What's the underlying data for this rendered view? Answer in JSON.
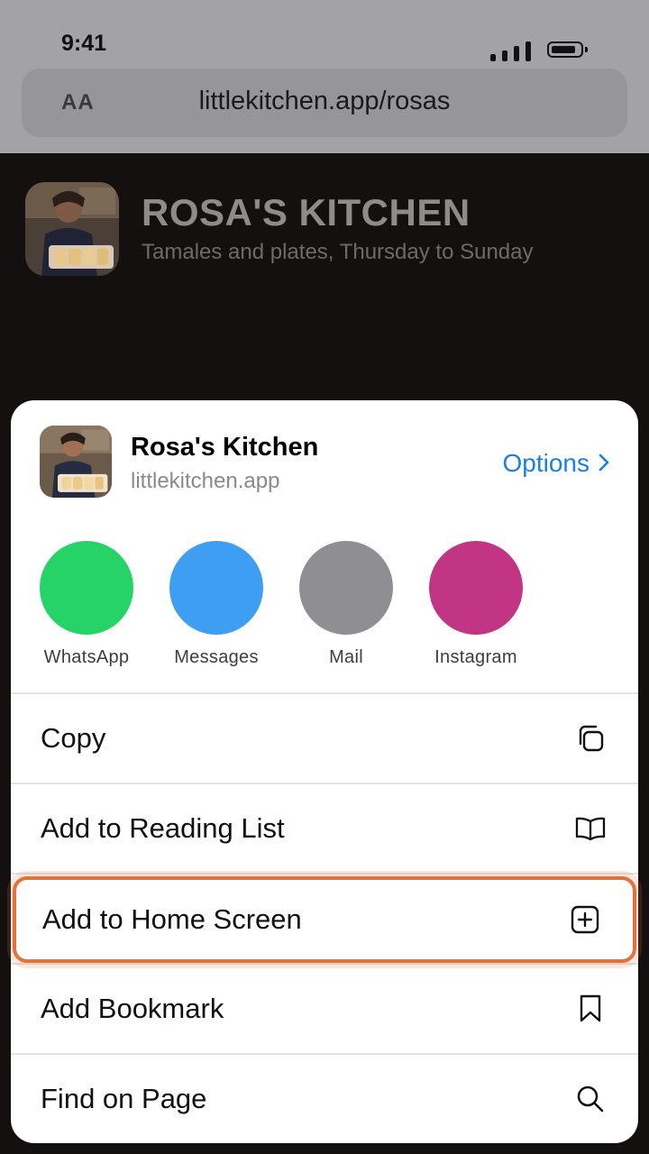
{
  "status_bar": {
    "time": "9:41"
  },
  "browser": {
    "text_size_label": "AA",
    "url": "littlekitchen.app/rosas"
  },
  "site": {
    "title": "ROSA'S KITCHEN",
    "subtitle": "Tamales and plates, Thursday to Sunday"
  },
  "share_sheet": {
    "title": "Rosa's Kitchen",
    "domain": "littlekitchen.app",
    "options_label": "Options",
    "apps": [
      {
        "label": "WhatsApp",
        "color": "#25d366"
      },
      {
        "label": "Messages",
        "color": "#3d9ef2"
      },
      {
        "label": "Mail",
        "color": "#8e8e93"
      },
      {
        "label": "Instagram",
        "color": "#c13584"
      }
    ],
    "actions": [
      {
        "label": "Copy",
        "icon": "copy-icon"
      },
      {
        "label": "Add to Reading List",
        "icon": "book-icon"
      },
      {
        "label": "Add to Home Screen",
        "icon": "add-square-icon",
        "highlighted": true
      },
      {
        "label": "Add Bookmark",
        "icon": "bookmark-icon"
      },
      {
        "label": "Find on Page",
        "icon": "search-icon"
      }
    ]
  },
  "colors": {
    "accent": "#1a80e6",
    "highlight": "#e0733d"
  }
}
